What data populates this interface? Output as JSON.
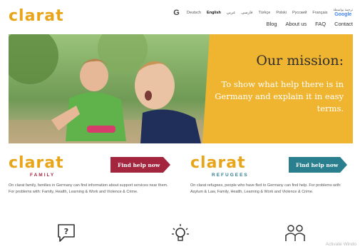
{
  "header": {
    "logo_text": "clarat",
    "languages": [
      {
        "label": "Deutsch",
        "active": false
      },
      {
        "label": "English",
        "active": true
      },
      {
        "label": "عربي",
        "active": false
      },
      {
        "label": "فارسی",
        "active": false
      },
      {
        "label": "Türkçe",
        "active": false
      },
      {
        "label": "Polski",
        "active": false
      },
      {
        "label": "Русский",
        "active": false
      },
      {
        "label": "Français",
        "active": false
      }
    ],
    "google_translate": {
      "top": "ترجمة بواسطة",
      "brand": "Google"
    },
    "nav": [
      "Blog",
      "About us",
      "FAQ",
      "Contact"
    ]
  },
  "hero": {
    "title": "Our mission:",
    "body": "To show what help there is in Germany and explain it in easy terms.",
    "accent_color": "#f0b530"
  },
  "cards": {
    "family": {
      "logo": "clarat",
      "sub": "FAMILY",
      "button": "Find help now",
      "description": "On clarat family, families in Germany can find information about support services near them. For problems with: Family, Health, Learning & Work and Violence & Crime.",
      "color": "#a3263e"
    },
    "refugees": {
      "logo": "clarat",
      "sub": "REFUGEES",
      "button": "Find help now",
      "description": "On clarat refugees, people who have fled to Germany can find help. For problems with: Asylum & Law, Family, Health, Learning & Work and Violence & Crime.",
      "color": "#2a7f8f"
    }
  },
  "features": {
    "icons": [
      "question-bubble-icon",
      "lightbulb-icon",
      "people-icon"
    ]
  },
  "watermark": "Activate Windo"
}
